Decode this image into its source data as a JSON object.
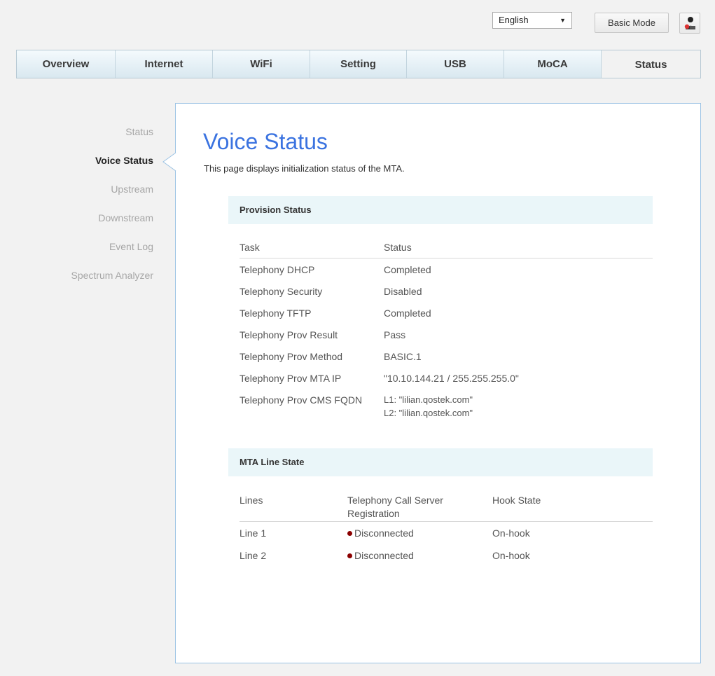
{
  "header": {
    "language": "English",
    "mode_button": "Basic Mode",
    "user_icon": "user-admin-icon"
  },
  "nav": {
    "tabs": [
      {
        "label": "Overview"
      },
      {
        "label": "Internet"
      },
      {
        "label": "WiFi"
      },
      {
        "label": "Setting"
      },
      {
        "label": "USB"
      },
      {
        "label": "MoCA"
      },
      {
        "label": "Status",
        "active": true
      }
    ]
  },
  "sidebar": {
    "items": [
      {
        "label": "Status"
      },
      {
        "label": "Voice Status",
        "active": true
      },
      {
        "label": "Upstream"
      },
      {
        "label": "Downstream"
      },
      {
        "label": "Event Log"
      },
      {
        "label": "Spectrum Analyzer"
      }
    ]
  },
  "page": {
    "title": "Voice Status",
    "description": "This page displays initialization status of the MTA."
  },
  "provision": {
    "heading": "Provision Status",
    "columns": [
      "Task",
      "Status"
    ],
    "rows": [
      {
        "task": "Telephony DHCP",
        "status": "Completed"
      },
      {
        "task": "Telephony Security",
        "status": "Disabled"
      },
      {
        "task": "Telephony TFTP",
        "status": "Completed"
      },
      {
        "task": "Telephony Prov Result",
        "status": "Pass"
      },
      {
        "task": "Telephony Prov Method",
        "status": "BASIC.1"
      },
      {
        "task": "Telephony Prov MTA IP",
        "status": "\"10.10.144.21 / 255.255.255.0\""
      },
      {
        "task": "Telephony Prov CMS FQDN",
        "status": "L1: \"lilian.qostek.com\"",
        "status2": "L2: \"lilian.qostek.com\""
      }
    ]
  },
  "mta": {
    "heading": "MTA Line State",
    "columns": [
      "Lines",
      "Telephony Call Server",
      "Registration",
      "Hook State"
    ],
    "rows": [
      {
        "line": "Line 1",
        "registration": "Disconnected",
        "hook": "On-hook"
      },
      {
        "line": "Line 2",
        "registration": "Disconnected",
        "hook": "On-hook"
      }
    ],
    "status_color": "#8b0000"
  },
  "colors": {
    "accent": "#3b73e0",
    "panel_border": "#9cc3e4",
    "section_bg": "#eaf6f9"
  }
}
